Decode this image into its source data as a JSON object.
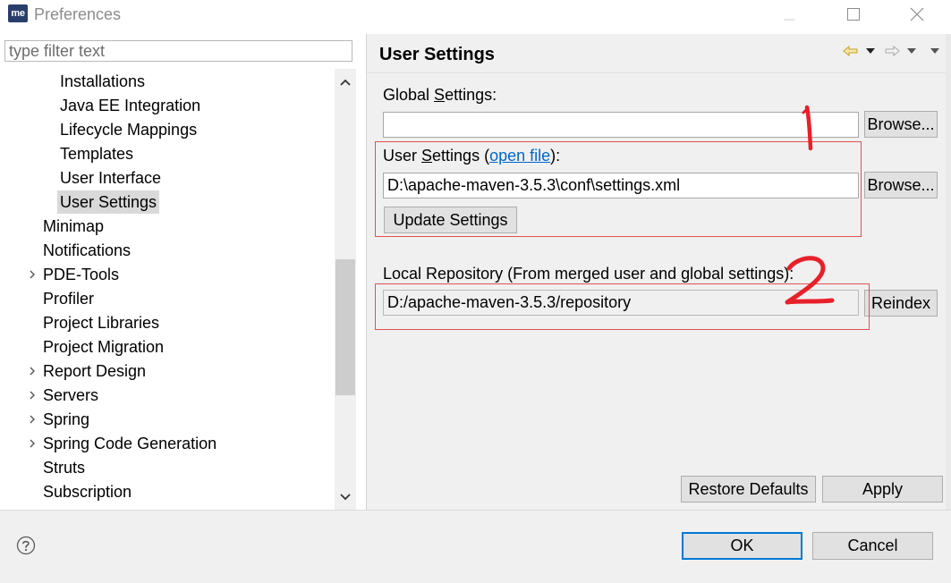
{
  "window": {
    "logo_text": "me",
    "title": "Preferences",
    "controls": [
      "minimize-icon",
      "maximize-icon",
      "close-icon"
    ]
  },
  "filter": {
    "placeholder": "type filter text",
    "value": ""
  },
  "tree": {
    "items": [
      {
        "label": "Installations",
        "level": 2,
        "expandable": false,
        "selected": false
      },
      {
        "label": "Java EE Integration",
        "level": 2,
        "expandable": false,
        "selected": false
      },
      {
        "label": "Lifecycle Mappings",
        "level": 2,
        "expandable": false,
        "selected": false
      },
      {
        "label": "Templates",
        "level": 2,
        "expandable": false,
        "selected": false
      },
      {
        "label": "User Interface",
        "level": 2,
        "expandable": false,
        "selected": false
      },
      {
        "label": "User Settings",
        "level": 2,
        "expandable": false,
        "selected": true
      },
      {
        "label": "Minimap",
        "level": 1,
        "expandable": false,
        "selected": false
      },
      {
        "label": "Notifications",
        "level": 1,
        "expandable": false,
        "selected": false
      },
      {
        "label": "PDE-Tools",
        "level": 1,
        "expandable": true,
        "selected": false
      },
      {
        "label": "Profiler",
        "level": 1,
        "expandable": false,
        "selected": false
      },
      {
        "label": "Project Libraries",
        "level": 1,
        "expandable": false,
        "selected": false
      },
      {
        "label": "Project Migration",
        "level": 1,
        "expandable": false,
        "selected": false
      },
      {
        "label": "Report Design",
        "level": 1,
        "expandable": true,
        "selected": false
      },
      {
        "label": "Servers",
        "level": 1,
        "expandable": true,
        "selected": false
      },
      {
        "label": "Spring",
        "level": 1,
        "expandable": true,
        "selected": false
      },
      {
        "label": "Spring Code Generation",
        "level": 1,
        "expandable": true,
        "selected": false
      },
      {
        "label": "Struts",
        "level": 1,
        "expandable": false,
        "selected": false
      },
      {
        "label": "Subscription",
        "level": 1,
        "expandable": false,
        "selected": false
      }
    ]
  },
  "page": {
    "title": "User Settings",
    "nav_icons": [
      "back-arrow-icon",
      "back-menu-icon",
      "forward-arrow-icon",
      "forward-menu-icon",
      "view-menu-icon"
    ],
    "global_settings": {
      "label_pre": "Global ",
      "label_mnemonic": "S",
      "label_post": "ettings:",
      "value": "",
      "browse_label": "Browse..."
    },
    "user_settings": {
      "label_pre": "User ",
      "label_mnemonic": "S",
      "label_post": "ettings (",
      "link_text": "open file",
      "label_end": "):",
      "value": "D:\\apache-maven-3.5.3\\conf\\settings.xml",
      "browse_label": "Browse...",
      "update_label": "Update Settings"
    },
    "local_repository": {
      "label": "Local Repository (From merged user and global settings):",
      "value": "D:/apache-maven-3.5.3/repository",
      "reindex_label": "Reindex"
    },
    "restore_defaults_label": "Restore Defaults",
    "apply_label": "Apply"
  },
  "annotations": {
    "mark_1": "1",
    "mark_2": "2",
    "color": "#e8202a"
  },
  "footer": {
    "ok_label": "OK",
    "cancel_label": "Cancel"
  },
  "colors": {
    "selection": "#d9d9d9",
    "link": "#0066cc",
    "default_button_border": "#0078d7",
    "panel_bg": "#f0f0f0"
  }
}
